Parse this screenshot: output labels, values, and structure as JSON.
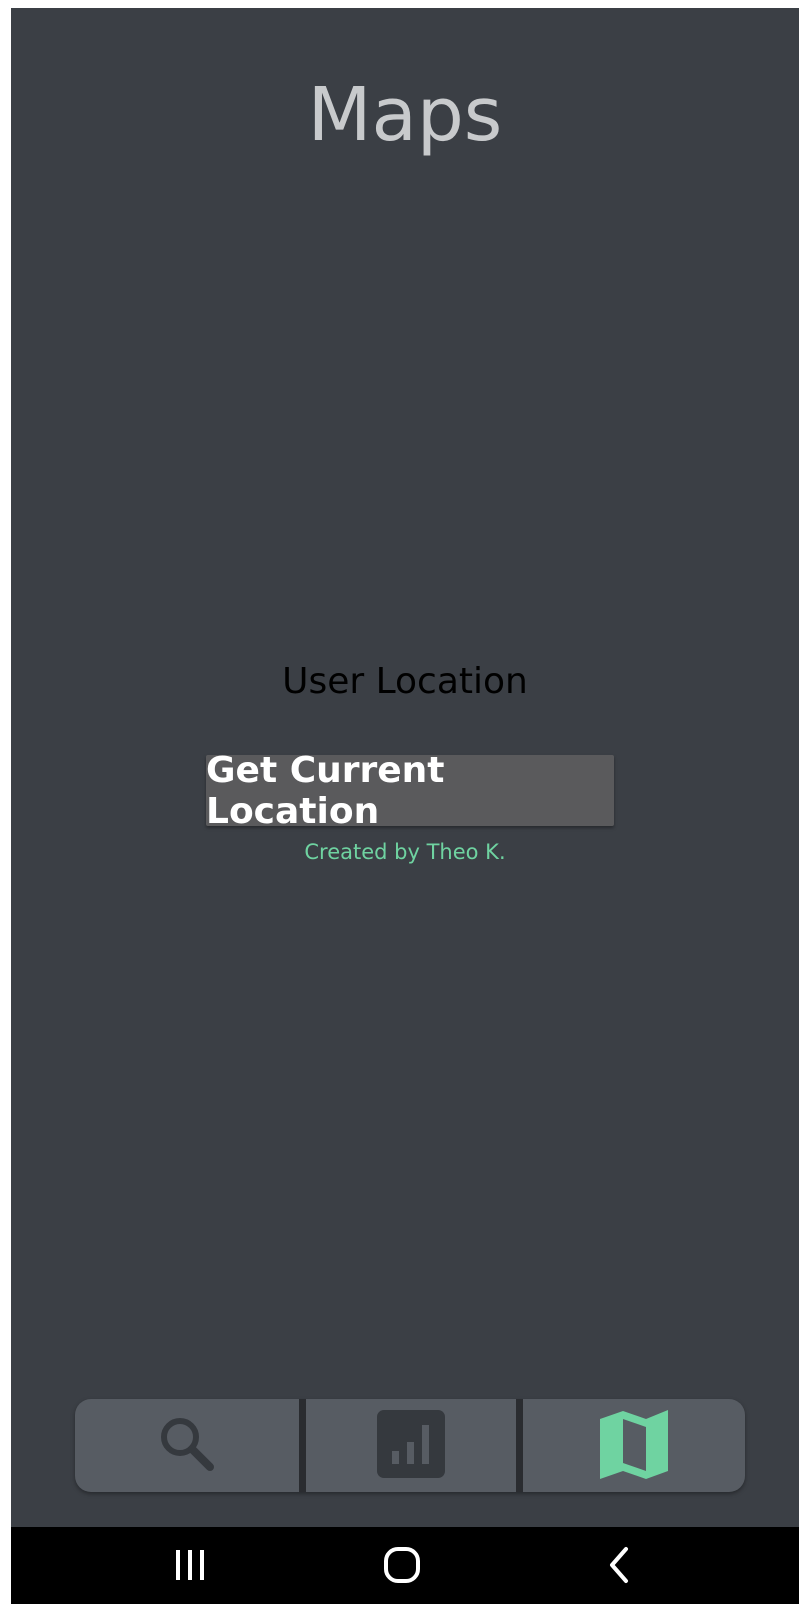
{
  "app": {
    "title": "Maps"
  },
  "main": {
    "section_label": "User Location",
    "button_label": "Get Current Location",
    "credit": "Created by Theo K."
  },
  "tabbar": {
    "tabs": [
      {
        "icon": "search-icon",
        "active": false
      },
      {
        "icon": "bar-chart-icon",
        "active": false
      },
      {
        "icon": "map-icon",
        "active": true
      }
    ]
  },
  "system_nav": {
    "buttons": [
      "recent-apps-icon",
      "home-icon",
      "back-icon"
    ]
  },
  "colors": {
    "background": "#3b3f45",
    "accent": "#6fd3a1",
    "tabbar": "#575c63",
    "button": "#5a5a5c"
  }
}
